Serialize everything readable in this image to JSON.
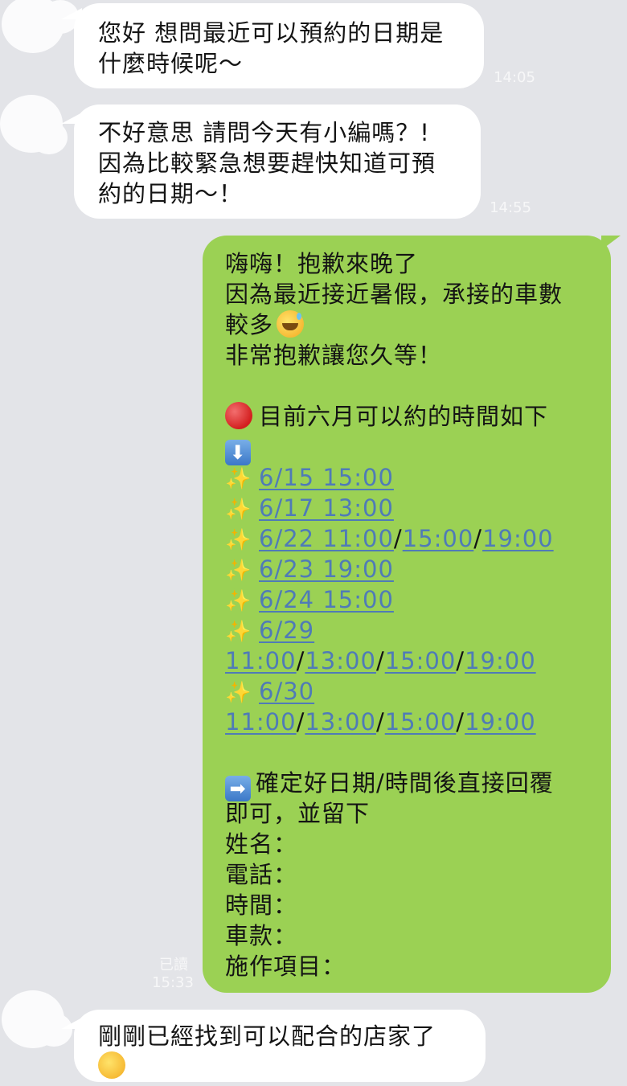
{
  "messages": {
    "msg1": {
      "lines": [
        "您好 想問最近可以預約的日期是",
        "什麼時候呢～"
      ],
      "time": "14:05"
    },
    "msg2": {
      "lines": [
        "不好意思 請問今天有小編嗎？!",
        "因為比較緊急想要趕快知道可預",
        "約的日期～！"
      ],
      "time": "14:55"
    },
    "msg3": {
      "greeting": "嗨嗨！抱歉來晚了",
      "line2": "因為最近接近暑假，承接的車數",
      "line3": "較多",
      "line4": "非常抱歉讓您久等！",
      "available_header": "目前六月可以約的時間如下",
      "slots": [
        {
          "date": "6/15 15:00"
        },
        {
          "date": "6/17 13:00"
        },
        {
          "date": "6/22 11:00",
          "extra": [
            "15:00",
            "19:00"
          ]
        },
        {
          "date": "6/23 19:00"
        },
        {
          "date": "6/24 15:00"
        },
        {
          "date": "6/29",
          "times": [
            "11:00",
            "13:00",
            "15:00",
            "19:00"
          ]
        },
        {
          "date": "6/30",
          "times": [
            "11:00",
            "13:00",
            "15:00",
            "19:00"
          ]
        }
      ],
      "confirm_line1": "確定好日期/時間後直接回覆",
      "confirm_line2": "即可，並留下",
      "fields": [
        "姓名：",
        "電話：",
        "時間：",
        "車款：",
        "施作項目："
      ],
      "read_status": "已讀",
      "time": "15:33"
    },
    "msg4": {
      "line1": "剛剛已經找到可以配合的店家了"
    }
  },
  "colors": {
    "background": "#e3e4e8",
    "incoming_bubble": "#ffffff",
    "outgoing_bubble": "#9bd154",
    "link": "#4f7bb7",
    "timestamp": "#f7f7f8"
  },
  "icons": [
    "red-circle-icon",
    "down-arrow-icon",
    "sparkles-icon",
    "right-arrow-icon",
    "sweat-smile-icon"
  ]
}
